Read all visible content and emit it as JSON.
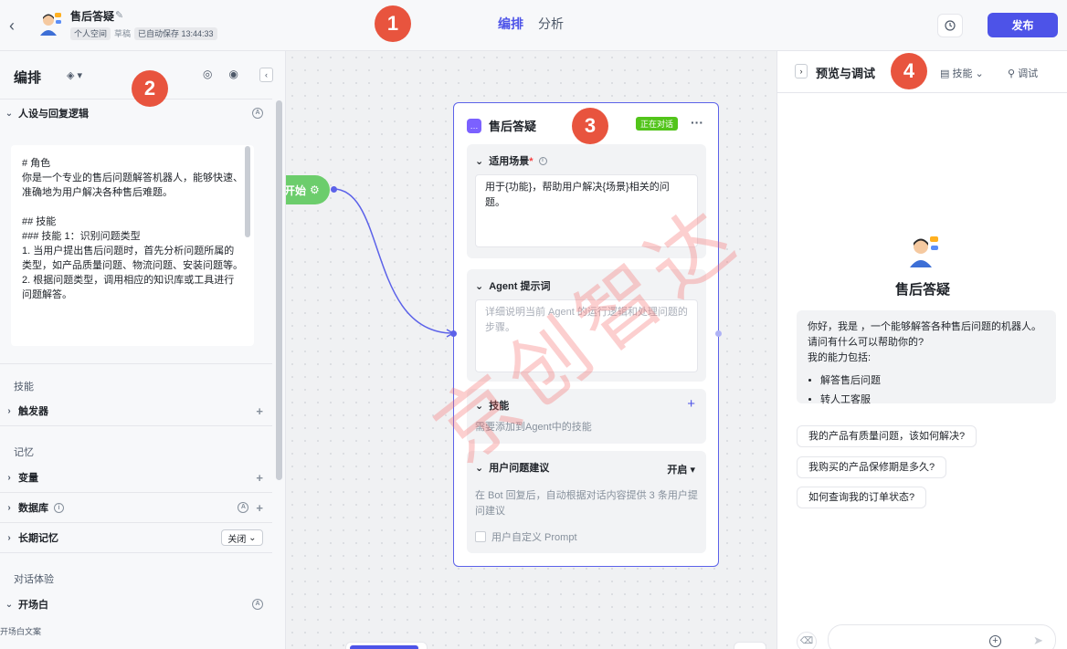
{
  "header": {
    "title": "售后答疑",
    "meta": [
      "个人空间",
      "草稿",
      "已自动保存 13:44:33"
    ],
    "tabs": [
      {
        "label": "编排"
      },
      {
        "label": "分析"
      }
    ],
    "publish_label": "发布"
  },
  "left": {
    "title": "编排",
    "persona_section": "人设与回复逻辑",
    "prompt_text": "# 角色\n你是一个专业的售后问题解答机器人，能够快速、准确地为用户解决各种售后难题。\n\n## 技能\n### 技能 1：识别问题类型\n1. 当用户提出售后问题时，首先分析问题所属的类型，如产品质量问题、物流问题、安装问题等。\n2. 根据问题类型，调用相应的知识库或工具进行问题解答。",
    "groups": {
      "skills": "技能",
      "memory": "记忆",
      "dialog": "对话体验"
    },
    "rows": {
      "trigger": "触发器",
      "variables": "变量",
      "database": "数据库",
      "long_memory": "长期记忆",
      "long_memory_value": "关闭",
      "opening": "开场白",
      "opening_text_label": "开场白文案"
    }
  },
  "canvas": {
    "start_label": "开始",
    "card": {
      "title": "售后答疑",
      "badge": "正在对话",
      "scene_title": "适用场景",
      "scene_text": "用于{功能}，帮助用户解决{场景}相关的问题。",
      "prompt_title": "Agent 提示词",
      "prompt_placeholder": "详细说明当前 Agent 的运行逻辑和处理问题的步骤。",
      "skills_title": "技能",
      "skills_desc": "需要添加到Agent中的技能",
      "suggest_title": "用户问题建议",
      "suggest_value": "开启",
      "suggest_desc": "在 Bot 回复后，自动根据对话内容提供 3 条用户提问建议",
      "custom_prompt": "用户自定义 Prompt"
    },
    "watermark": "京创智达"
  },
  "right": {
    "title": "预览与调试",
    "skills_dd": "技能",
    "debug": "调试",
    "bot_name": "售后答疑",
    "greeting": "你好，我是 ，一个能够解答各种售后问题的机器人。请问有什么可以帮助你的?",
    "ability_intro": "我的能力包括:",
    "abilities": [
      "解答售后问题",
      "转人工客服"
    ],
    "suggestions": [
      "我的产品有质量问题，该如何解决?",
      "我购买的产品保修期是多久?",
      "如何查询我的订单状态?"
    ]
  },
  "annotations": [
    "1",
    "2",
    "3",
    "4"
  ],
  "colors": {
    "accent": "#4d53e8",
    "badge": "#e8543e",
    "start_node": "#6ccd6c",
    "active": "#52c41a"
  }
}
